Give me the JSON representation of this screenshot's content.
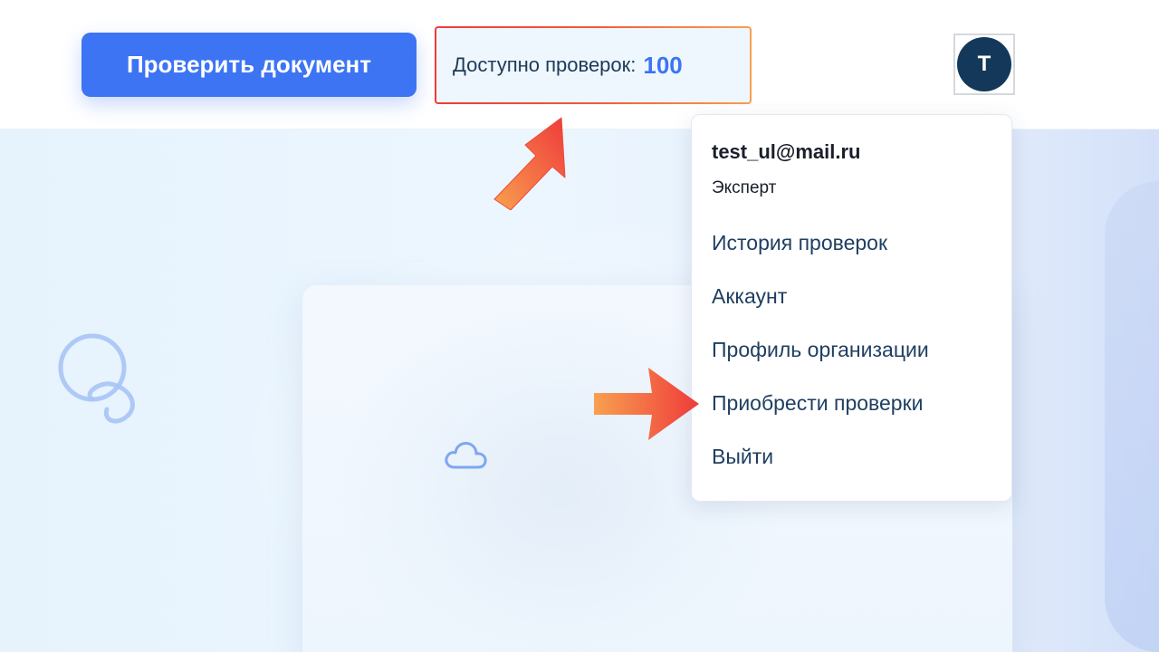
{
  "header": {
    "check_document_label": "Проверить документ",
    "checks_available_label": "Доступно проверок:",
    "checks_available_count": "100",
    "avatar_initial": "T"
  },
  "user_menu": {
    "email": "test_ul@mail.ru",
    "role": "Эксперт",
    "items": [
      {
        "label": "История проверок"
      },
      {
        "label": "Аккаунт"
      },
      {
        "label": "Профиль организации"
      },
      {
        "label": "Приобрести проверки"
      },
      {
        "label": "Выйти"
      }
    ]
  },
  "colors": {
    "primary": "#3d74f4",
    "avatar_bg": "#13385a",
    "highlight_start": "#ef3b3b",
    "highlight_end": "#f7a04e"
  },
  "icons": {
    "background_left": "swirl-icon",
    "card": "cloud-icon",
    "annotation_1": "arrow-up-right-icon",
    "annotation_2": "arrow-right-icon"
  }
}
